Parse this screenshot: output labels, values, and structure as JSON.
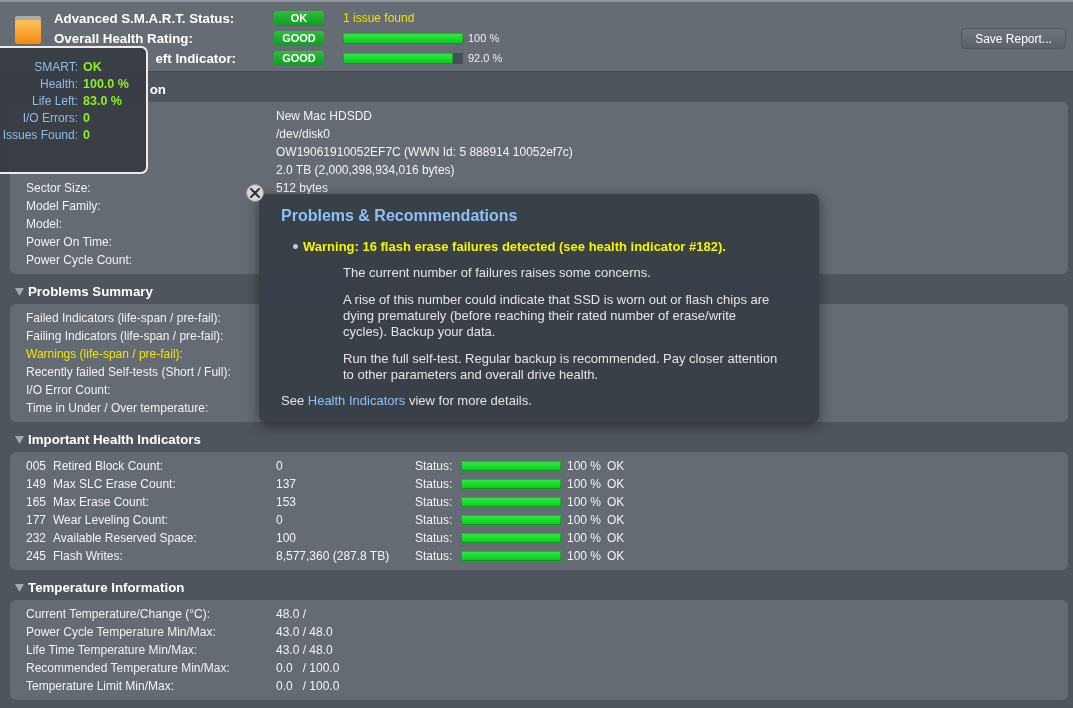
{
  "header": {
    "rows": [
      {
        "label": "Advanced S.M.A.R.T. Status:",
        "badge": "OK",
        "kind": "note",
        "note": "1 issue found"
      },
      {
        "label": "Overall Health Rating:",
        "badge": "GOOD",
        "kind": "meter",
        "level": 1.0,
        "reading": "100 %"
      },
      {
        "label": "eft Indicator:",
        "badge": "GOOD",
        "kind": "meter",
        "level": 0.92,
        "reading": "92.0 %"
      }
    ],
    "save_button": "Save Report..."
  },
  "sections": [
    {
      "title": "on",
      "expanded": true,
      "kind": "info",
      "rows": [
        {
          "value": "New Mac HDSDD"
        },
        {
          "value": "/dev/disk0"
        },
        {
          "value": "OW19061910052EF7C (WWN Id: 5 888914 10052ef7c)"
        },
        {
          "value": "2.0 TB (2,000,398,934,016 bytes)"
        },
        {
          "label": "Sector Size:",
          "value": "512 bytes"
        },
        {
          "label": "Model Family:"
        },
        {
          "label": "Model:"
        },
        {
          "label": "Power On Time:"
        },
        {
          "label": "Power Cycle Count:"
        }
      ]
    },
    {
      "title": "Problems Summary",
      "expanded": true,
      "kind": "info",
      "rows": [
        {
          "label": "Failed Indicators (life-span / pre-fail):",
          "warning": false
        },
        {
          "label": "Failing Indicators (life-span / pre-fail):",
          "warning": false
        },
        {
          "label": "Warnings (life-span / pre-fail):",
          "warning": true
        },
        {
          "label": "Recently failed Self-tests (Short / Full):",
          "warning": false
        },
        {
          "label": "I/O Error Count:",
          "warning": false
        },
        {
          "label": "Time in Under / Over temperature:",
          "warning": false
        }
      ]
    },
    {
      "title": "Important Health Indicators",
      "expanded": true,
      "kind": "indicators",
      "rows": [
        {
          "code": "005",
          "name": "Retired Block Count:",
          "value": "0",
          "status_label": "Status:",
          "level": 1.0,
          "reading": "100 %",
          "status": "OK"
        },
        {
          "code": "149",
          "name": "Max SLC Erase Count:",
          "value": "137",
          "status_label": "Status:",
          "level": 1.0,
          "reading": "100 %",
          "status": "OK"
        },
        {
          "code": "165",
          "name": "Max Erase Count:",
          "value": "153",
          "status_label": "Status:",
          "level": 1.0,
          "reading": "100 %",
          "status": "OK"
        },
        {
          "code": "177",
          "name": "Wear Leveling Count:",
          "value": "0",
          "status_label": "Status:",
          "level": 1.0,
          "reading": "100 %",
          "status": "OK"
        },
        {
          "code": "232",
          "name": "Available Reserved Space:",
          "value": "100",
          "status_label": "Status:",
          "level": 1.0,
          "reading": "100 %",
          "status": "OK"
        },
        {
          "code": "245",
          "name": "Flash Writes:",
          "value": "8,577,360 (287.8 TB)",
          "status_label": "Status:",
          "level": 1.0,
          "reading": "100 %",
          "status": "OK"
        }
      ]
    },
    {
      "title": "Temperature Information",
      "expanded": true,
      "kind": "info",
      "rows": [
        {
          "label": "Current Temperature/Change (°C):",
          "value": "48.0 /"
        },
        {
          "label": "Power Cycle Temperature Min/Max:",
          "value": "43.0 / 48.0"
        },
        {
          "label": "Life Time Temperature Min/Max:",
          "value": "43.0 / 48.0"
        },
        {
          "label": "Recommended Temperature Min/Max:",
          "value": "0.0   / 100.0"
        },
        {
          "label": "Temperature Limit Min/Max:",
          "value": "0.0   / 100.0"
        }
      ]
    }
  ],
  "summary_overlay": {
    "rows": [
      {
        "label": "SMART:",
        "value": "OK"
      },
      {
        "label": "Health:",
        "value": "100.0 %"
      },
      {
        "label": "Life Left:",
        "value": "83.0 %"
      },
      {
        "label": "I/O Errors:",
        "value": "0"
      },
      {
        "label": "Issues Found:",
        "value": "0"
      }
    ]
  },
  "recommendations": {
    "title": "Problems & Recommendations",
    "items": [
      {
        "warning": "Warning: 16 flash erase failures detected (see health indicator #182).",
        "paragraphs": [
          [
            "The current number of failures raises some concerns."
          ],
          [
            "A rise of this number could indicate that SSD is worn out or flash chips are",
            "dying prematurely (before reaching their rated number of erase/write",
            "cycles). Backup your data."
          ],
          [
            "Run the full self-test. Regular backup is recommended. Pay closer attention",
            "to other parameters and overall drive health."
          ]
        ]
      }
    ],
    "footer": {
      "before": "See",
      "link": "Health Indicators",
      "after": "view for more details."
    }
  }
}
